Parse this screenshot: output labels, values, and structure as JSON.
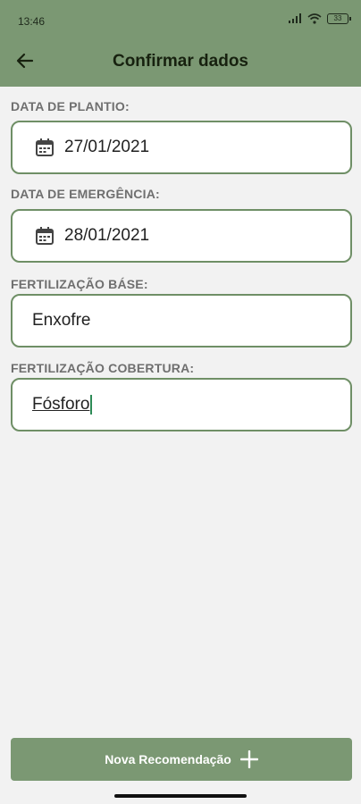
{
  "status_bar": {
    "time": "13:46",
    "battery": "33"
  },
  "header": {
    "title": "Confirmar dados",
    "back_icon": "arrow-left-icon"
  },
  "fields": [
    {
      "label": "DATA DE PLANTIO:",
      "value": "27/01/2021",
      "icon": "calendar-icon"
    },
    {
      "label": "DATA DE EMERGÊNCIA:",
      "value": "28/01/2021",
      "icon": "calendar-icon"
    },
    {
      "label": "FERTILIZAÇÃO BÁSE:",
      "value": "Enxofre"
    },
    {
      "label": "FERTILIZAÇÃO COBERTURA:",
      "value": "Fósforo"
    }
  ],
  "footer": {
    "button_label": "Nova Recomendação",
    "button_icon": "plus-icon"
  },
  "colors": {
    "primary": "#7b9873",
    "border": "#6f8f66",
    "background": "#f2f2f2"
  }
}
